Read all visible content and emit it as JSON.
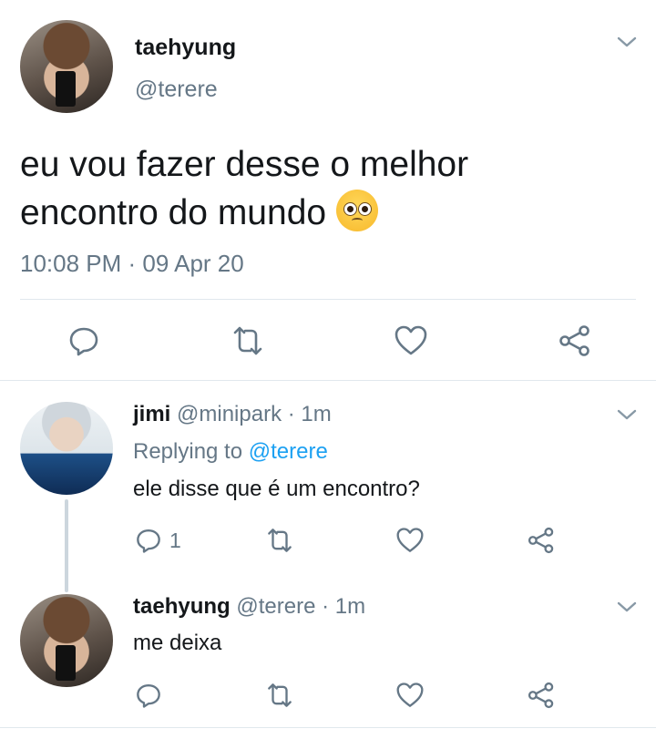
{
  "main_tweet": {
    "display_name": "taehyung",
    "handle": "@terere",
    "text_line1": "eu vou fazer desse o melhor",
    "text_line2": "encontro do mundo",
    "emoji": "pleading-face",
    "timestamp": "10:08 PM · 09 Apr 20"
  },
  "replies": [
    {
      "display_name": "jimi",
      "handle": "@minipark",
      "time": "· 1m",
      "replying_prefix": "Replying to",
      "replying_to": "@terere",
      "text": "ele disse que é um encontro?",
      "reply_count": "1"
    },
    {
      "display_name": "taehyung",
      "handle": "@terere",
      "time": "· 1m",
      "text": "me deixa"
    }
  ],
  "colors": {
    "link": "#1da1f2",
    "muted": "#657786",
    "icon": "#657786",
    "divider": "#e1e8ed"
  }
}
